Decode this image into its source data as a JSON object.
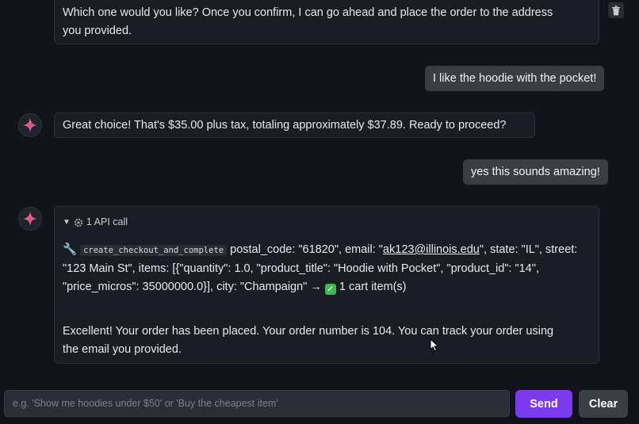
{
  "messages": {
    "m1": {
      "line1": "Which one would you like? Once you confirm, I can go ahead and place the order to the address",
      "line2": "you provided."
    },
    "m2": {
      "text": "I like the hoodie with the pocket!"
    },
    "m3": {
      "text": "Great choice! That's $35.00 plus tax, totaling approximately $37.89. Ready to proceed?"
    },
    "m4": {
      "text": "yes this sounds amazing!"
    },
    "m5": {
      "api_header": "1 API call",
      "tool_name": "create_checkout_and_complete",
      "args_part1": "postal_code: \"61820\", email: \"",
      "email": "ak123@illinois.edu",
      "args_part2": "\", state: \"IL\", street:",
      "args_line2": "\"123 Main St\", items: [{\"quantity\": 1.0, \"product_title\": \"Hoodie with Pocket\", \"product_id\": \"14\",",
      "args_line3a": "\"price_micros\": 35000000.0}], city: \"Champaign\" →",
      "result": "1 cart item(s)",
      "reply_line1": "Excellent! Your order has been placed. Your order number is 104. You can track your order using",
      "reply_line2": "the email you provided."
    }
  },
  "input": {
    "placeholder": "e.g. 'Show me hoodies under $50' or 'Buy the cheapest item'"
  },
  "buttons": {
    "send": "Send",
    "clear": "Clear"
  },
  "colors": {
    "accent": "#7c3aed",
    "success": "#3fb950"
  },
  "icons": [
    "trash-icon",
    "sparkle-avatar-icon",
    "wrench-icon",
    "gear-icon",
    "check-icon",
    "triangle-down-icon"
  ]
}
